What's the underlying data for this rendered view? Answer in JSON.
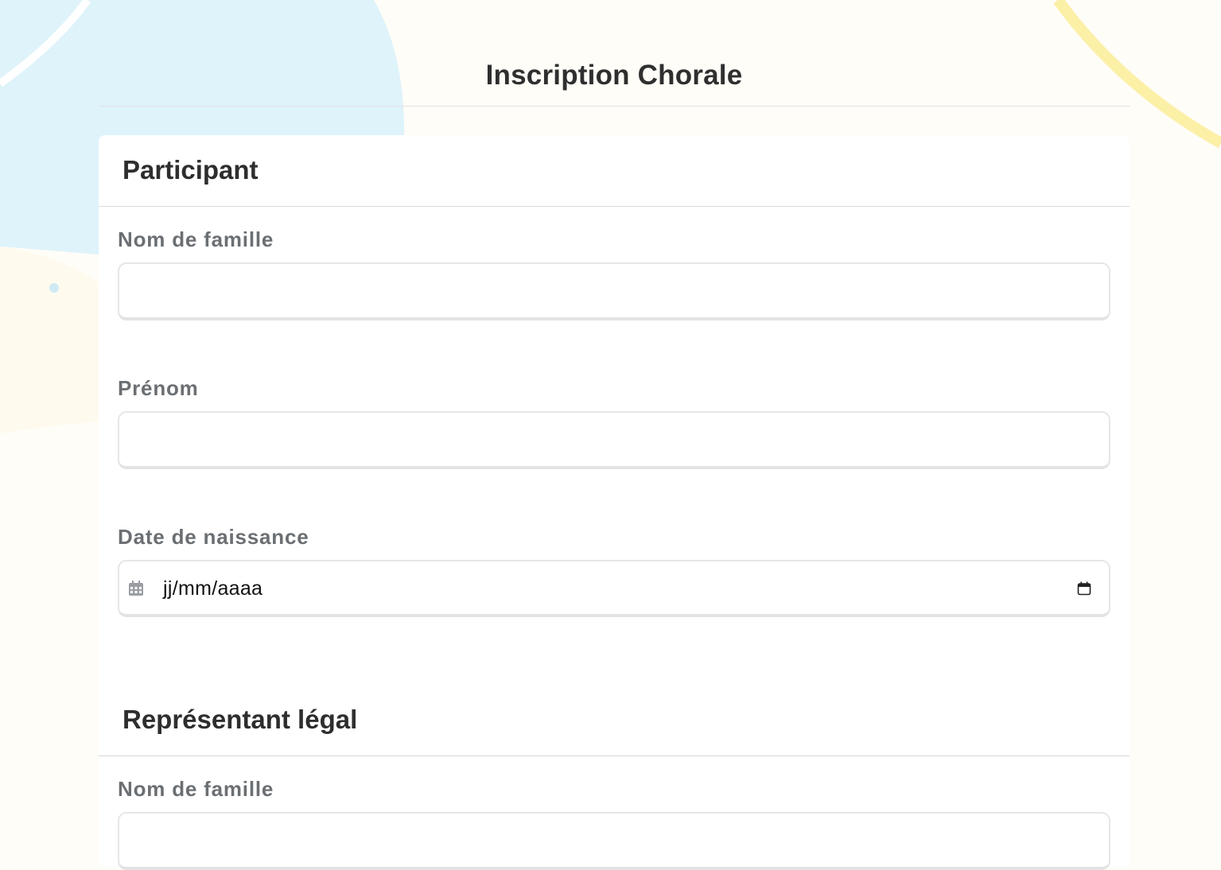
{
  "page": {
    "title": "Inscription Chorale"
  },
  "sections": [
    {
      "title": "Participant",
      "fields": [
        {
          "label": "Nom de famille",
          "value": ""
        },
        {
          "label": "Prénom",
          "value": ""
        },
        {
          "label": "Date de naissance",
          "placeholder": "jj/mm/aaaa"
        }
      ]
    },
    {
      "title": "Représentant légal",
      "fields": [
        {
          "label": "Nom de famille",
          "value": ""
        }
      ]
    }
  ],
  "colors": {
    "background": "#fffdf7",
    "blob_blue": "#dff3fa",
    "ring_yellow": "#fcefa6",
    "label_gray": "#6b6f73",
    "title_dark": "#2f2f2f"
  },
  "icons": {
    "date_left": "calendar-grid-icon",
    "date_right": "calendar-picker-icon"
  }
}
